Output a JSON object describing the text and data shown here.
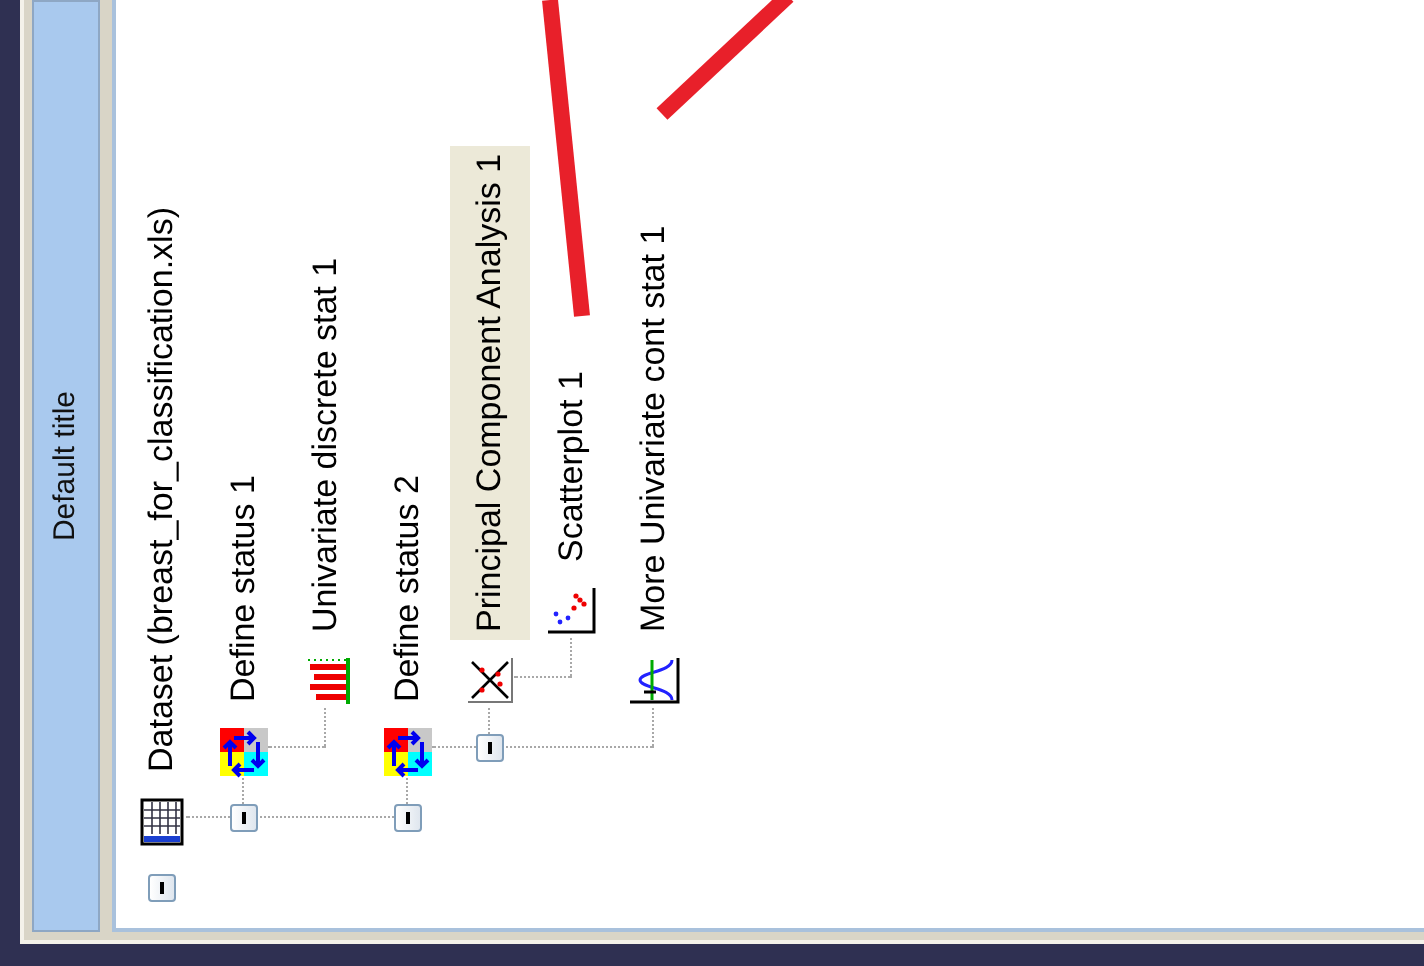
{
  "window": {
    "title": "Default title"
  },
  "tree": [
    {
      "label": "Dataset (breast_for_classification.xls)",
      "kind": "dataset",
      "expanded": true,
      "selected": false,
      "children": [
        {
          "label": "Define status 1",
          "kind": "define-status",
          "expanded": true,
          "selected": false,
          "children": [
            {
              "label": "Univariate discrete stat 1",
              "kind": "discrete-stat",
              "selected": false
            }
          ]
        },
        {
          "label": "Define status 2",
          "kind": "define-status",
          "expanded": true,
          "selected": false,
          "children": [
            {
              "label": "Principal Component Analysis 1",
              "kind": "pca",
              "expanded": true,
              "selected": true,
              "children": [
                {
                  "label": "Scatterplot 1",
                  "kind": "scatterplot",
                  "selected": false
                }
              ]
            },
            {
              "label": "More Univariate cont stat 1",
              "kind": "cont-stat",
              "selected": false
            }
          ]
        }
      ]
    }
  ]
}
